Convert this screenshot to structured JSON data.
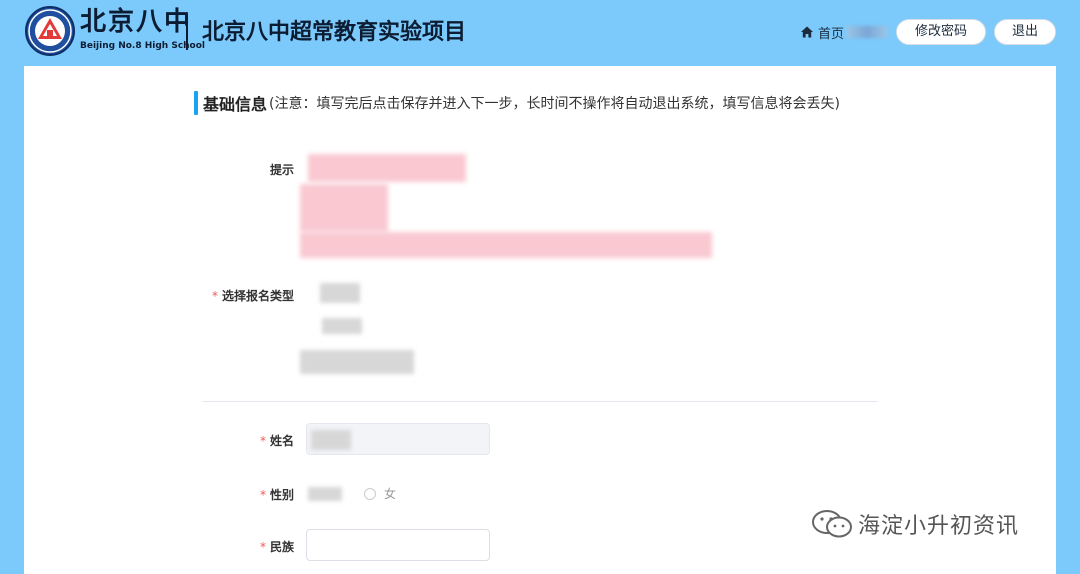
{
  "header": {
    "logo_cn": "北京八中",
    "logo_en": "Beijing No.8 High School",
    "title": "北京八中超常教育实验项目",
    "home_label": "首页",
    "change_password_label": "修改密码",
    "logout_label": "退出"
  },
  "section": {
    "title": "基础信息",
    "note": "(注意：填写完后点击保存并进入下一步，长时间不操作将自动退出系统，填写信息将会丢失)"
  },
  "form": {
    "hint_label": "提示",
    "type_label": "选择报名类型",
    "name_label": "姓名",
    "gender_label": "性别",
    "gender_female": "女",
    "ethnicity_label": "民族",
    "required_mark": "*"
  },
  "watermark": {
    "text": "海淀小升初资讯"
  },
  "colors": {
    "page_bg": "#7cc9fb",
    "accent": "#1aa3f0",
    "required": "#f05a5a",
    "panel_bg": "#ffffff"
  },
  "icons": {
    "home": "home-icon",
    "logo": "school-emblem-icon",
    "watermark": "wechat-icon"
  }
}
